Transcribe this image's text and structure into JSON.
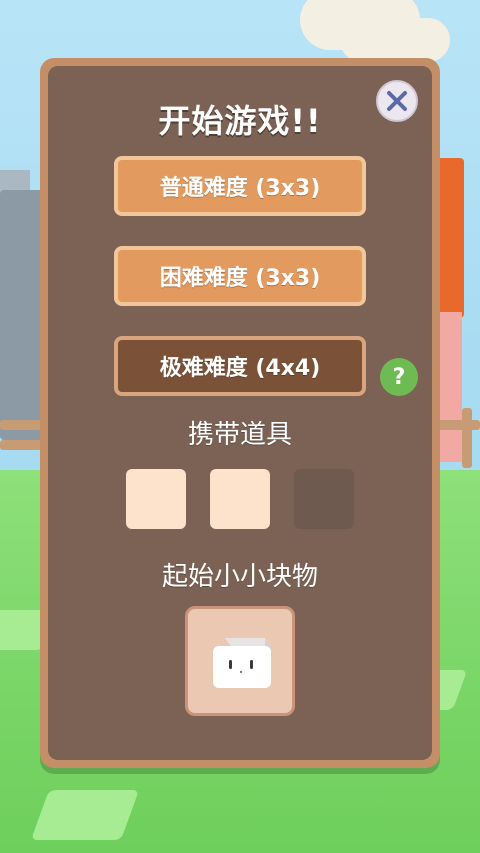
{
  "dialog": {
    "title": "开始游戏!!",
    "close_icon": "x-icon"
  },
  "difficulty": {
    "normal_label": "普通难度 (3x3)",
    "hard_label": "困难难度 (3x3)",
    "extreme_label": "极难难度 (4x4)",
    "selected": "extreme",
    "help_label": "?"
  },
  "items_section": {
    "title": "携带道具",
    "slots": [
      {
        "state": "available"
      },
      {
        "state": "available"
      },
      {
        "state": "locked"
      }
    ]
  },
  "start_block_section": {
    "title": "起始小小块物",
    "block_icon": "white-cube-character"
  },
  "colors": {
    "panel_border": "#c48f67",
    "panel_fill": "#7b6254",
    "button_orange": "#e39a5f",
    "button_selected": "#7b5237",
    "help_green": "#6fbb53"
  }
}
